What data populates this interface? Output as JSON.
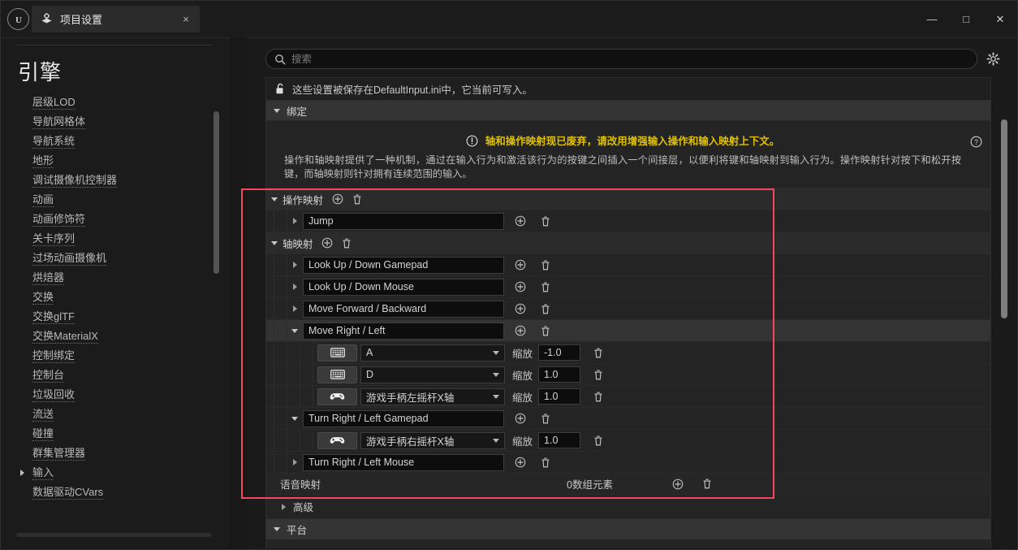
{
  "window": {
    "logo": "ue-logo",
    "tab_title": "项目设置",
    "tab_close": "×",
    "minimize": "—",
    "maximize": "□",
    "close": "✕"
  },
  "sidebar": {
    "heading": "引擎",
    "items": [
      {
        "label": "层级LOD",
        "expandable": false
      },
      {
        "label": "导航网格体",
        "expandable": false
      },
      {
        "label": "导航系统",
        "expandable": false
      },
      {
        "label": "地形",
        "expandable": false
      },
      {
        "label": "调试摄像机控制器",
        "expandable": false
      },
      {
        "label": "动画",
        "expandable": false
      },
      {
        "label": "动画修饰符",
        "expandable": false
      },
      {
        "label": "关卡序列",
        "expandable": false
      },
      {
        "label": "过场动画摄像机",
        "expandable": false
      },
      {
        "label": "烘焙器",
        "expandable": false
      },
      {
        "label": "交换",
        "expandable": false
      },
      {
        "label": "交换glTF",
        "expandable": false
      },
      {
        "label": "交换MaterialX",
        "expandable": false
      },
      {
        "label": "控制绑定",
        "expandable": false
      },
      {
        "label": "控制台",
        "expandable": false
      },
      {
        "label": "垃圾回收",
        "expandable": false
      },
      {
        "label": "流送",
        "expandable": false
      },
      {
        "label": "碰撞",
        "expandable": false
      },
      {
        "label": "群集管理器",
        "expandable": false
      },
      {
        "label": "输入",
        "expandable": true
      },
      {
        "label": "数据驱动CVars",
        "expandable": false
      }
    ]
  },
  "search": {
    "placeholder": "搜索",
    "value": ""
  },
  "notice": {
    "text": "这些设置被保存在DefaultInput.ini中，它当前可写入。"
  },
  "bindings_section": {
    "title": "绑定"
  },
  "deprecation": {
    "warning": "轴和操作映射现已废弃，请改用增强输入操作和输入映射上下文。",
    "description": "操作和轴映射提供了一种机制，通过在输入行为和激活该行为的按键之间插入一个间接层，以便利将键和轴映射到输入行为。操作映射针对按下和松开按键，而轴映射则针对拥有连续范围的输入。"
  },
  "action_mappings": {
    "title": "操作映射",
    "items": [
      {
        "name": "Jump",
        "expanded": false,
        "keys": []
      }
    ]
  },
  "axis_mappings": {
    "title": "轴映射",
    "scale_label": "缩放",
    "items": [
      {
        "name": "Look Up / Down Gamepad",
        "expanded": false,
        "keys": []
      },
      {
        "name": "Look Up / Down Mouse",
        "expanded": false,
        "keys": []
      },
      {
        "name": "Move Forward / Backward",
        "expanded": false,
        "keys": []
      },
      {
        "name": "Move Right / Left",
        "expanded": true,
        "keys": [
          {
            "device": "keyboard",
            "key": "A",
            "scale": "-1.0"
          },
          {
            "device": "keyboard",
            "key": "D",
            "scale": "1.0"
          },
          {
            "device": "gamepad",
            "key": "游戏手柄左摇杆X轴",
            "scale": "1.0"
          }
        ]
      },
      {
        "name": "Turn Right / Left Gamepad",
        "expanded": true,
        "keys": [
          {
            "device": "gamepad",
            "key": "游戏手柄右摇杆X轴",
            "scale": "1.0"
          }
        ]
      },
      {
        "name": "Turn Right / Left Mouse",
        "expanded": false,
        "keys": []
      }
    ]
  },
  "speech_mappings": {
    "label": "语音映射",
    "value": "0数组元素"
  },
  "advanced": {
    "label": "高级"
  },
  "platform": {
    "label": "平台"
  },
  "colors": {
    "warning_yellow": "#e0c000",
    "annotation_red": "#f4475b",
    "panel_bg": "#242424",
    "header_bg": "#343434"
  }
}
